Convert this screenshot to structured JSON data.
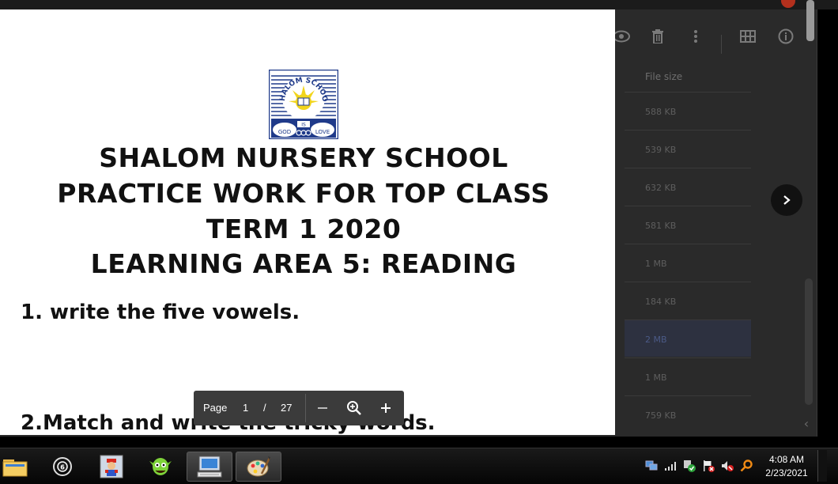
{
  "drive": {
    "column_header": "File size",
    "file_sizes": [
      "588 KB",
      "539 KB",
      "632 KB",
      "581 KB",
      "1 MB",
      "184 KB",
      "2 MB",
      "1 MB",
      "759 KB"
    ],
    "highlighted_row": 6,
    "toolbar_icons": [
      "eye-icon",
      "trash-icon",
      "more-vert-icon",
      "grid-view-icon",
      "info-icon"
    ]
  },
  "document": {
    "logo": {
      "ring_text": "SHALOM SCHOOL",
      "left_text": "GOD",
      "center_text": "IS",
      "right_text": "LOVE"
    },
    "title_lines": [
      "SHALOM NURSERY SCHOOL",
      "PRACTICE WORK FOR TOP CLASS",
      "TERM 1 2020",
      "LEARNING AREA 5: READING"
    ],
    "question_1": "1. write the five vowels.",
    "question_2": "2.Match and write the tricky words."
  },
  "pdf_controls": {
    "page_label": "Page",
    "current_page": "1",
    "separator": "/",
    "total_pages": "27"
  },
  "taskbar": {
    "time": "4:08 AM",
    "date": "2/23/2021",
    "apps": [
      "file-explorer-icon",
      "media-player-icon",
      "game-mario-icon",
      "game-goblin-icon",
      "computer-icon",
      "paint-icon"
    ]
  },
  "colors": {
    "document_bg": "#ffffff",
    "overlay_bg": "#2a2a2a",
    "controls_bg": "#3b3b3b",
    "logo_blue": "#1f3a8a",
    "logo_yellow": "#f2d51c"
  }
}
